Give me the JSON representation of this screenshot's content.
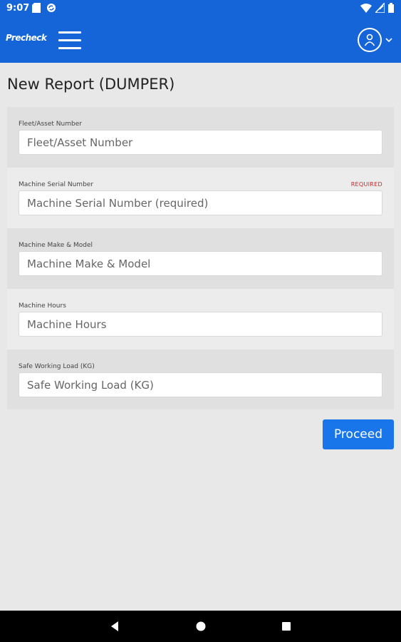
{
  "status_bar": {
    "time": "9:07"
  },
  "app_bar": {
    "logo_text": "Precheck"
  },
  "page": {
    "title": "New Report (DUMPER)"
  },
  "form": {
    "fields": [
      {
        "label": "Fleet/Asset Number",
        "placeholder": "Fleet/Asset Number",
        "required": ""
      },
      {
        "label": "Machine Serial Number",
        "placeholder": "Machine Serial Number (required)",
        "required": "REQUIRED"
      },
      {
        "label": "Machine Make & Model",
        "placeholder": "Machine Make & Model",
        "required": ""
      },
      {
        "label": "Machine Hours",
        "placeholder": "Machine Hours",
        "required": ""
      },
      {
        "label": "Safe Working Load (KG)",
        "placeholder": "Safe Working Load (KG)",
        "required": ""
      }
    ],
    "proceed_label": "Proceed"
  },
  "colors": {
    "primary": "#1565d8",
    "button": "#1976ea",
    "required": "#c62828"
  }
}
